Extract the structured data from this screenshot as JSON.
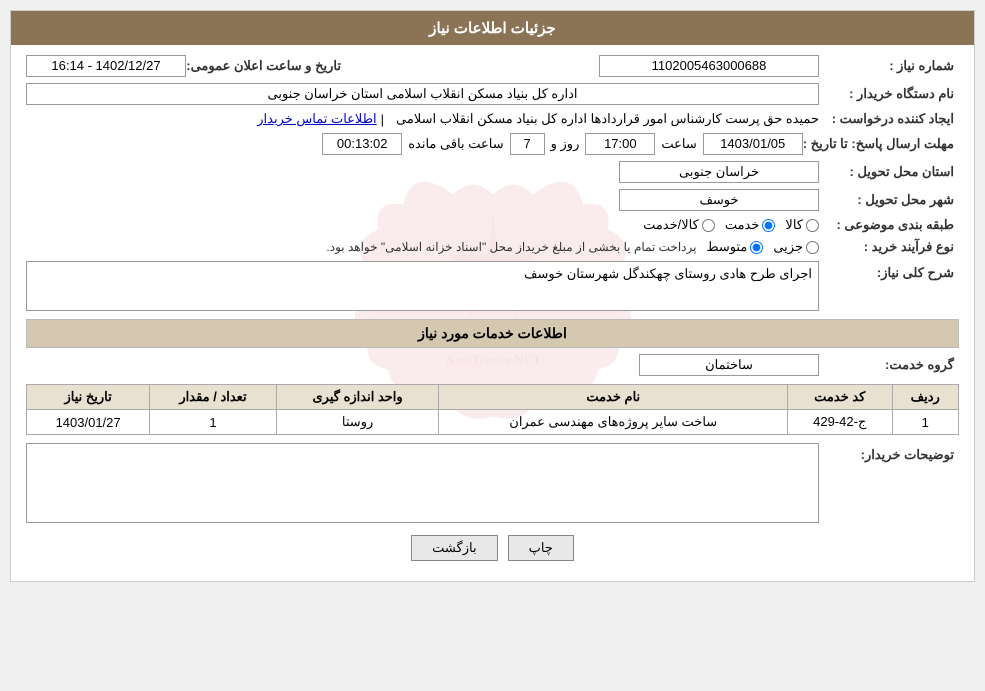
{
  "header": {
    "title": "جزئیات اطلاعات نیاز"
  },
  "fields": {
    "shomare_niaz_label": "شماره نیاز :",
    "shomare_niaz_value": "1102005463000688",
    "nam_dastgah_label": "نام دستگاه خریدار :",
    "nam_dastgah_value": "اداره کل بنیاد مسکن انقلاب اسلامی استان خراسان جنوبی",
    "ijad_konande_label": "ایجاد کننده درخواست :",
    "ijad_konande_value": "حمیده حق پرست کارشناس امور قراردادها اداره کل بنیاد مسکن انقلاب اسلامی",
    "ijad_konande_link": "اطلاعات تماس خریدار",
    "mohlat_label": "مهلت ارسال پاسخ: تا تاریخ :",
    "tarikh_value": "1403/01/05",
    "saat_label": "ساعت",
    "saat_value": "17:00",
    "rooz_label": "روز و",
    "rooz_value": "7",
    "baqi_label": "ساعت باقی مانده",
    "baqi_value": "00:13:02",
    "tarikh_elam_label": "تاریخ و ساعت اعلان عمومی:",
    "tarikh_elam_value": "1402/12/27 - 16:14",
    "ostan_label": "استان محل تحویل :",
    "ostan_value": "خراسان جنوبی",
    "shahr_label": "شهر محل تحویل :",
    "shahr_value": "خوسف",
    "tabaqe_label": "طبقه بندی موضوعی :",
    "tabaqe_kala": "کالا",
    "tabaqe_khadamat": "خدمت",
    "tabaqe_kala_khadamat": "کالا/خدمت",
    "tabaqe_selected": "khadamat",
    "nov_farayand_label": "نوع فرآیند خرید :",
    "nov_jozii": "جزیی",
    "nov_mottaset": "متوسط",
    "nov_note": "پرداخت تمام یا بخشی از مبلغ خریداز محل \"اسناد خزانه اسلامی\" خواهد بود.",
    "nov_selected": "mottaset",
    "sharh_label": "شرح کلی نیاز:",
    "sharh_value": "اجرای طرح هادی روستای چهکندگل شهرستان خوسف",
    "khadamat_section": "اطلاعات خدمات مورد نیاز",
    "gorooh_label": "گروه خدمت:",
    "gorooh_value": "ساختمان",
    "table_headers": {
      "radif": "ردیف",
      "kod": "کد خدمت",
      "name": "نام خدمت",
      "unit": "واحد اندازه گیری",
      "count": "تعداد / مقدار",
      "date": "تاریخ نیاز"
    },
    "table_rows": [
      {
        "radif": "1",
        "kod": "ج-42-429",
        "name": "ساخت سایر پروژه‌های مهندسی عمران",
        "unit": "روستا",
        "count": "1",
        "date": "1403/01/27"
      }
    ],
    "tosif_label": "توضیحات خریدار:",
    "tosif_value": "",
    "btn_print": "چاپ",
    "btn_back": "بازگشت"
  }
}
